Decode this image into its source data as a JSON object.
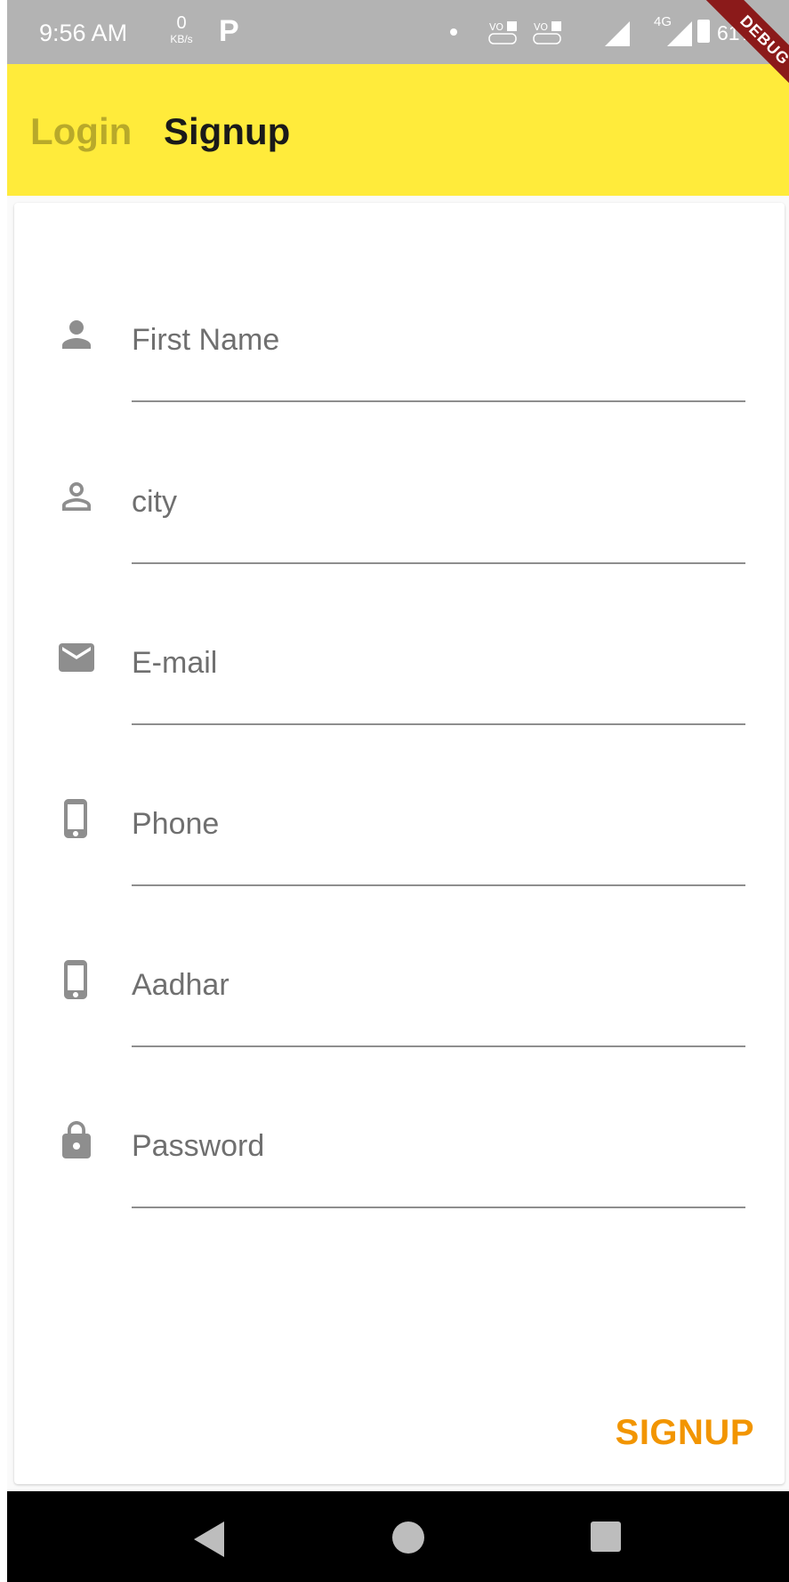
{
  "status_bar": {
    "time": "9:56 AM",
    "net_speed": "0",
    "net_unit": "KB/s",
    "app_icon": "P",
    "network_type": "4G",
    "battery": "61%",
    "icons": [
      "volte-sim1-icon",
      "volte-sim2-icon",
      "signal-icon",
      "battery-icon"
    ]
  },
  "debug_banner": "DEBUG",
  "app_bar": {
    "tabs": [
      {
        "label": "Login",
        "active": false
      },
      {
        "label": "Signup",
        "active": true
      }
    ],
    "background": "#ffeb3b"
  },
  "form": {
    "fields": [
      {
        "placeholder": "First Name",
        "icon": "person-filled-icon",
        "value": ""
      },
      {
        "placeholder": "city",
        "icon": "person-outline-icon",
        "value": ""
      },
      {
        "placeholder": "E-mail",
        "icon": "email-icon",
        "value": ""
      },
      {
        "placeholder": "Phone",
        "icon": "phone-icon",
        "value": ""
      },
      {
        "placeholder": "Aadhar",
        "icon": "phone-icon",
        "value": ""
      },
      {
        "placeholder": "Password",
        "icon": "lock-icon",
        "value": ""
      }
    ],
    "submit_label": "SIGNUP",
    "accent_color": "#f29500"
  },
  "nav_bar": {
    "icons": [
      "back-icon",
      "home-icon",
      "recents-icon"
    ]
  }
}
